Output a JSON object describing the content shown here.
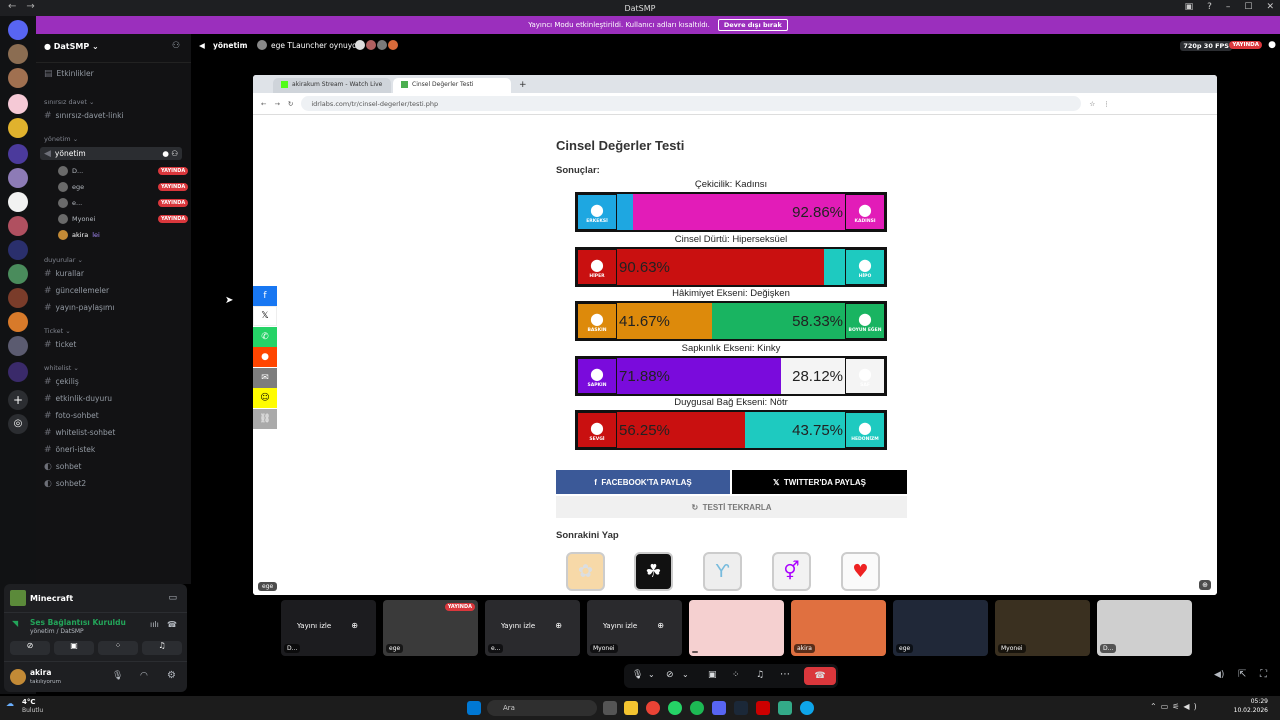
{
  "window": {
    "title": "DatSMP"
  },
  "notice": {
    "text": "Yayıncı Modu etkinleştirildi. Kullanıcı adları kısaltıldı.",
    "button": "Devre dışı bırak"
  },
  "guild": {
    "name": "DatSMP"
  },
  "channels": {
    "events": "Etkinlikler",
    "cat1": "sınırsız davet",
    "c1": "sınırsız-davet-linki",
    "cat2": "yönetim",
    "voice": "yönetim",
    "users": [
      {
        "name": "D...",
        "live": "YAYINDA"
      },
      {
        "name": "ege",
        "live": "YAYINDA"
      },
      {
        "name": "e...",
        "live": "YAYINDA"
      },
      {
        "name": "Myonei",
        "live": "YAYINDA"
      },
      {
        "name": "akira",
        "extra": "lei"
      }
    ],
    "cat3": "duyurular",
    "c2": "kurallar",
    "c3": "güncellemeler",
    "c4": "yayın-paylaşımı",
    "cat4": "Ticket",
    "c5": "ticket",
    "cat5": "whitelist",
    "c6": "çekiliş",
    "c7": "etkinlik-duyuru",
    "c8": "foto-sohbet",
    "c9": "whitelist-sohbet",
    "c10": "öneri-istek",
    "c11": "sohbet",
    "c12": "sohbet2"
  },
  "user_panel": {
    "activity": "Minecraft",
    "voice_status": "Ses Bağlantısı Kuruldu",
    "voice_channel": "yönetim / DatSMP",
    "username": "akira",
    "user_status": "takılıyorum"
  },
  "topbar": {
    "channel": "yönetim",
    "activity": "ege TLauncher oynuyor",
    "quality": "720p 30 FPS",
    "live": "YAYINDA"
  },
  "browser": {
    "tab1": "akirakum Stream - Watch Live",
    "tab2": "Cinsel Değerler Testi",
    "url": "idrlabs.com/tr/cinsel-degerler/testi.php"
  },
  "test": {
    "title": "Cinsel Değerler Testi",
    "results_label": "Sonuçlar:",
    "axes": [
      {
        "label": "Çekicilik: Kadınsı",
        "left_icon": "ERKEKSİ",
        "right_icon": "KADINSI",
        "left_pct": "",
        "right_pct": "92.86%",
        "left_val": 7.14,
        "right_val": 92.86,
        "left_color": "#1ea7e1",
        "right_color": "#e21cb8"
      },
      {
        "label": "Cinsel Dürtü: Hiperseksüel",
        "left_icon": "HİPER",
        "right_icon": "HİPO",
        "left_pct": "90.63%",
        "right_pct": "",
        "left_val": 90.63,
        "right_val": 9.37,
        "left_color": "#c91010",
        "right_color": "#1ecac0"
      },
      {
        "label": "Hâkimiyet Ekseni: Değişken",
        "left_icon": "BASKIN",
        "right_icon": "BOYUN EĞEN",
        "left_pct": "41.67%",
        "right_pct": "58.33%",
        "left_val": 41.67,
        "right_val": 58.33,
        "left_color": "#dd8a0b",
        "right_color": "#19b461"
      },
      {
        "label": "Sapkınlık Ekseni: Kinky",
        "left_icon": "SAPKIN",
        "right_icon": "SAF",
        "left_pct": "71.88%",
        "right_pct": "28.12%",
        "left_val": 71.88,
        "right_val": 28.12,
        "left_color": "#7a0bdc",
        "right_color": "#f4f4f4"
      },
      {
        "label": "Duygusal Bağ Ekseni: Nötr",
        "left_icon": "SEVGİ",
        "right_icon": "HEDONİZM",
        "left_pct": "56.25%",
        "right_pct": "43.75%",
        "left_val": 56.25,
        "right_val": 43.75,
        "left_color": "#c91010",
        "right_color": "#1ecac0"
      }
    ],
    "share_fb": "FACEBOOK'TA PAYLAŞ",
    "share_tw": "TWITTER'DA PAYLAŞ",
    "retry": "TESTİ TEKRARLA",
    "next_label": "Sonrakini Yap"
  },
  "stream_tag": "ege",
  "thumbs": [
    {
      "tag": "D...",
      "watch": "Yayını izle"
    },
    {
      "tag": "ege",
      "live": "YAYINDA"
    },
    {
      "tag": "e...",
      "watch": "Yayını izle"
    },
    {
      "tag": "Myonei",
      "watch": "Yayını izle"
    },
    {
      "tag": ""
    },
    {
      "tag": "akira"
    },
    {
      "tag": "ege"
    },
    {
      "tag": "Myonei"
    },
    {
      "tag": "D..."
    }
  ],
  "taskbar": {
    "weather_temp": "4°C",
    "weather_desc": "Bulutlu",
    "search": "Ara",
    "time": "05:29",
    "date": "10.02.2026"
  }
}
